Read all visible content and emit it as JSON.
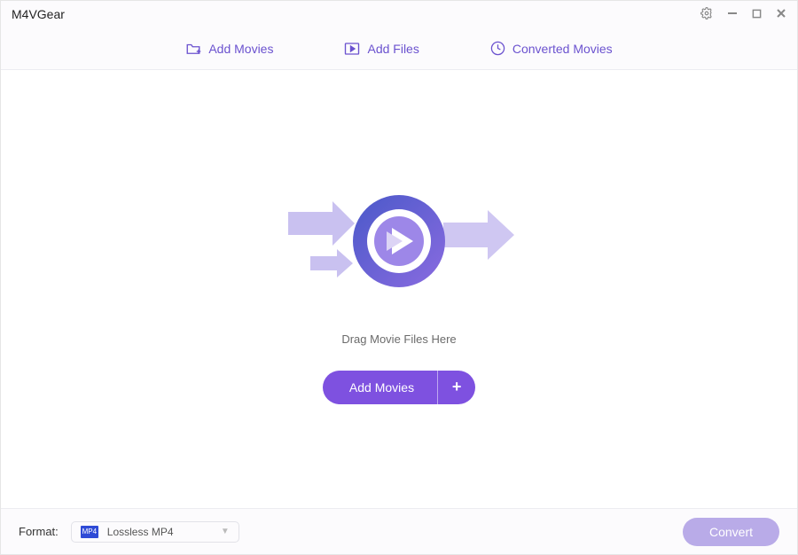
{
  "app": {
    "title": "M4VGear"
  },
  "toolbar": {
    "add_movies": "Add Movies",
    "add_files": "Add Files",
    "converted_movies": "Converted Movies"
  },
  "main": {
    "drag_text": "Drag Movie Files Here",
    "cta_label": "Add Movies",
    "cta_plus": "+"
  },
  "footer": {
    "format_label": "Format:",
    "format_badge": "MP4",
    "format_selected": "Lossless MP4",
    "convert_label": "Convert"
  }
}
